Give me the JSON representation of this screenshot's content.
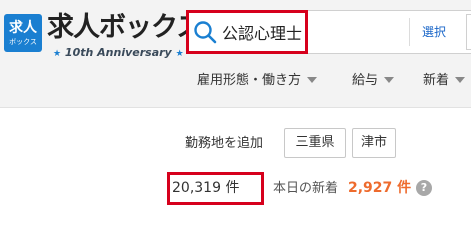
{
  "logo": {
    "badge_top": "求人",
    "badge_bottom": "ボックス",
    "main": "求人ボックス",
    "sub": "10th Anniversary"
  },
  "search": {
    "value": "公認心理士",
    "select_label": "選択"
  },
  "filters": [
    {
      "label": "雇用形態・働き方"
    },
    {
      "label": "給与"
    },
    {
      "label": "新着"
    }
  ],
  "location": {
    "label": "勤務地を追加",
    "tags": [
      "三重県",
      "津市"
    ]
  },
  "results": {
    "count": "20,319",
    "unit": "件",
    "new_label": "本日の新着",
    "new_count": "2,927 件",
    "help": "?"
  },
  "colors": {
    "brand": "#1a7fd1",
    "highlight": "#d6001c",
    "new_count": "#ee6b2d"
  }
}
